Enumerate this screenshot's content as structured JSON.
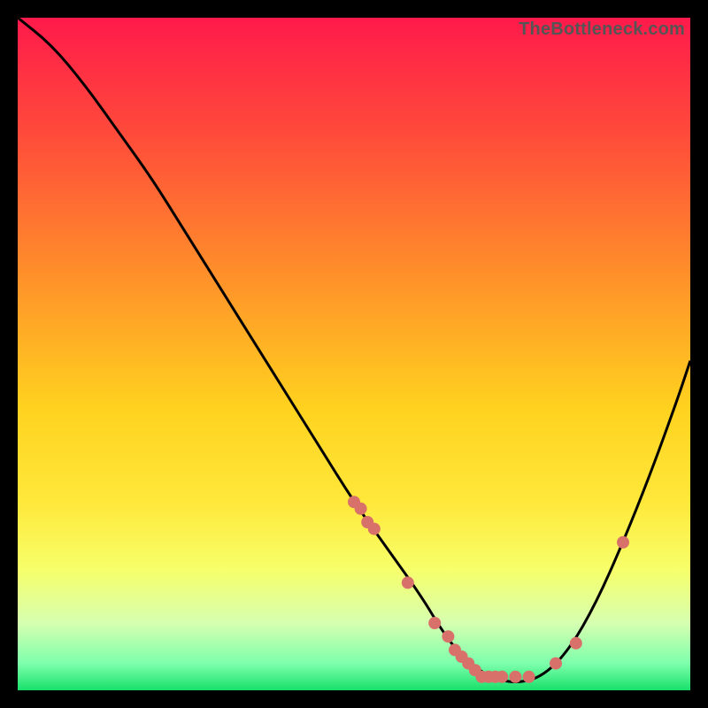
{
  "watermark": "TheBottleneck.com",
  "chart_data": {
    "type": "line",
    "title": "",
    "xlabel": "",
    "ylabel": "",
    "xlim": [
      0,
      100
    ],
    "ylim": [
      0,
      100
    ],
    "grid": false,
    "legend": "none",
    "gradient_stops": [
      {
        "offset": 0.0,
        "color": "#ff1a4b"
      },
      {
        "offset": 0.18,
        "color": "#ff4d3a"
      },
      {
        "offset": 0.38,
        "color": "#ff8f2a"
      },
      {
        "offset": 0.58,
        "color": "#ffd21f"
      },
      {
        "offset": 0.72,
        "color": "#ffe83a"
      },
      {
        "offset": 0.82,
        "color": "#f7ff6a"
      },
      {
        "offset": 0.9,
        "color": "#d6ffb0"
      },
      {
        "offset": 0.96,
        "color": "#7dffac"
      },
      {
        "offset": 1.0,
        "color": "#18e06a"
      }
    ],
    "series": [
      {
        "name": "bottleneck-curve",
        "type": "line",
        "stroke": "#000000",
        "x": [
          0,
          5,
          10,
          15,
          20,
          25,
          30,
          35,
          40,
          45,
          50,
          55,
          60,
          63,
          66,
          70,
          74,
          78,
          82,
          86,
          90,
          94,
          98,
          100
        ],
        "values": [
          100,
          96,
          90,
          83,
          76,
          68,
          60,
          52,
          44,
          36,
          28,
          21,
          14,
          9,
          5,
          2,
          1,
          2,
          6,
          13,
          22,
          32,
          43,
          49
        ]
      },
      {
        "name": "sample-dots",
        "type": "scatter",
        "color": "#d9716b",
        "x": [
          50,
          51,
          52,
          53,
          58,
          62,
          64,
          65,
          66,
          67,
          68,
          69,
          70,
          71,
          72,
          74,
          76,
          80,
          83,
          90
        ],
        "values": [
          28,
          27,
          25,
          24,
          16,
          10,
          8,
          6,
          5,
          4,
          3,
          2,
          2,
          2,
          2,
          2,
          2,
          4,
          7,
          22
        ]
      }
    ]
  }
}
